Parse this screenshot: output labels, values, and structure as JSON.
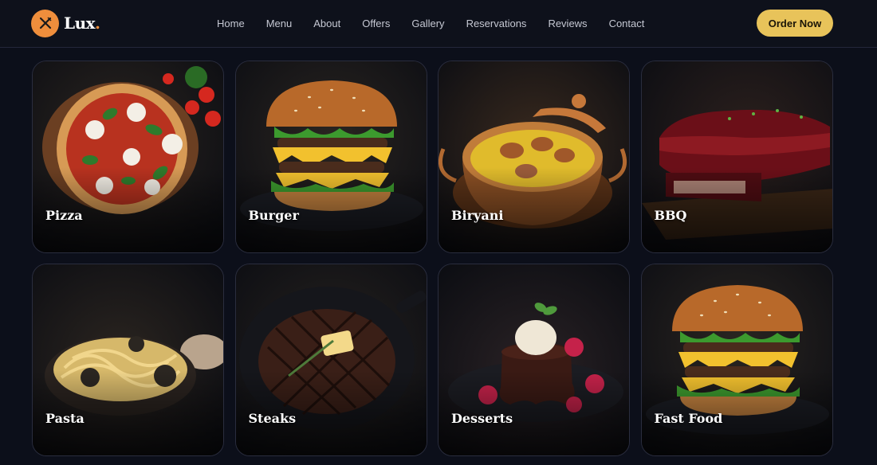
{
  "brand": {
    "name": "Lux",
    "dot": ".",
    "accent": "#ef8e3c"
  },
  "nav": {
    "items": [
      {
        "label": "Home"
      },
      {
        "label": "Menu"
      },
      {
        "label": "About"
      },
      {
        "label": "Offers"
      },
      {
        "label": "Gallery"
      },
      {
        "label": "Reservations"
      },
      {
        "label": "Reviews"
      },
      {
        "label": "Contact"
      }
    ]
  },
  "cta": {
    "label": "Order Now",
    "color": "#e8c35a"
  },
  "categories": [
    {
      "label": "Pizza",
      "icon": "pizza-image"
    },
    {
      "label": "Burger",
      "icon": "burger-image"
    },
    {
      "label": "Biryani",
      "icon": "biryani-image"
    },
    {
      "label": "BBQ",
      "icon": "bbq-image"
    },
    {
      "label": "Pasta",
      "icon": "pasta-image"
    },
    {
      "label": "Steaks",
      "icon": "steak-image"
    },
    {
      "label": "Desserts",
      "icon": "dessert-image"
    },
    {
      "label": "Fast Food",
      "icon": "fast-food-image"
    }
  ],
  "colors": {
    "background": "#0c0f1a",
    "card_border": "#2a2d3e",
    "nav_text": "#c5c8d3"
  }
}
